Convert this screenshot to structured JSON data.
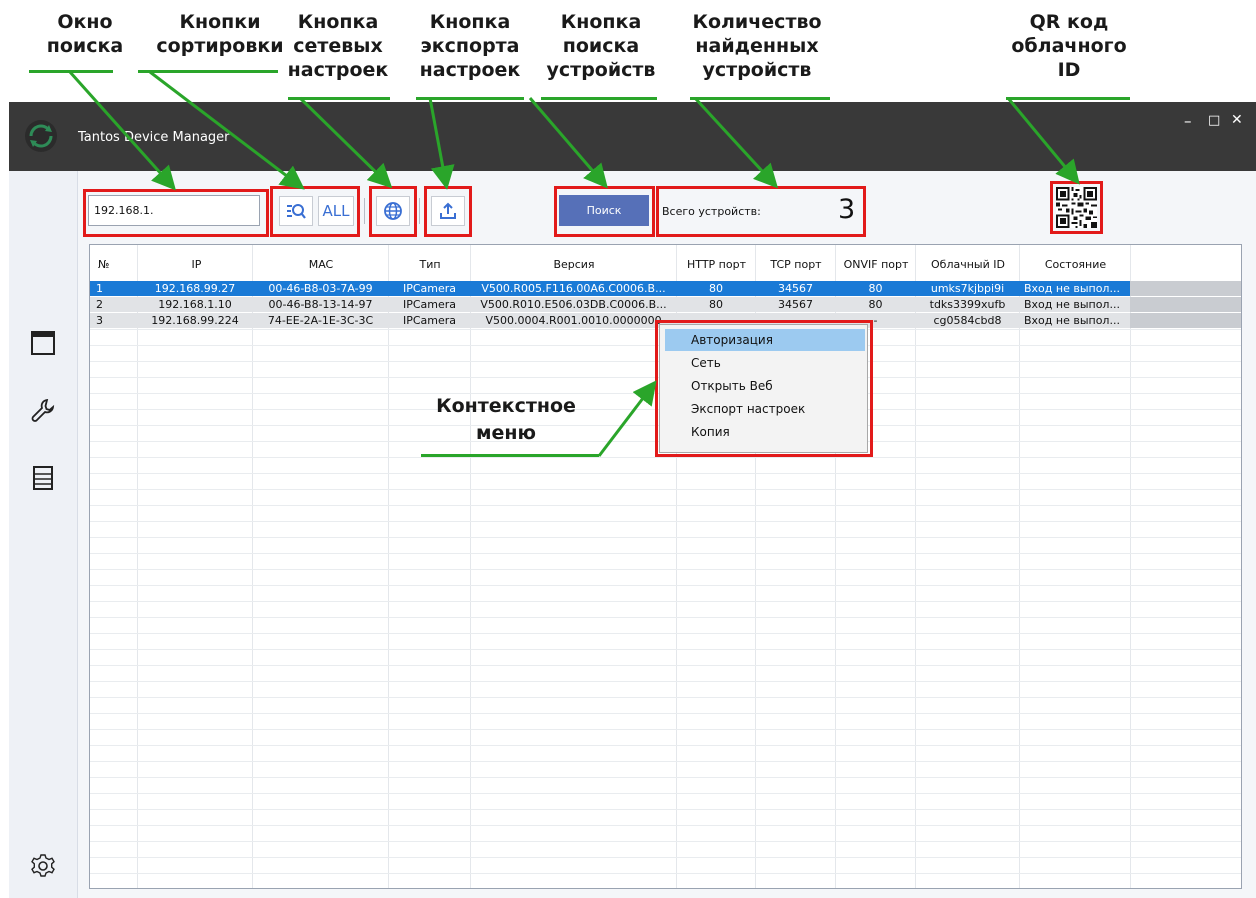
{
  "annotations": {
    "search_window": [
      "Окно",
      "поиска"
    ],
    "sort_buttons": [
      "Кнопки",
      "сортировки"
    ],
    "network_button": [
      "Кнопка",
      "сетевых",
      "настроек"
    ],
    "export_button": [
      "Кнопка",
      "экспорта",
      "настроек"
    ],
    "search_button": [
      "Кнопка",
      "поиска",
      "устройств"
    ],
    "device_count": [
      "Количество",
      "найденных",
      "устройств"
    ],
    "qr_code": [
      "QR код",
      "облачного",
      "ID"
    ],
    "context_menu": [
      "Контекстное",
      "меню"
    ]
  },
  "window": {
    "title": "Tantos Device Manager",
    "minimize": "–",
    "maximize": "□",
    "close": "✕"
  },
  "toolbar": {
    "search_value": "192.168.1.",
    "all_label": "ALL",
    "search_button": "Поиск",
    "count_label": "Всего устройств:",
    "count_value": "3"
  },
  "table": {
    "headers": [
      "№",
      "IP",
      "MAC",
      "Тип",
      "Версия",
      "HTTP порт",
      "TCP порт",
      "ONVIF порт",
      "Облачный ID",
      "Состояние"
    ],
    "rows": [
      [
        "1",
        "192.168.99.27",
        "00-46-B8-03-7A-99",
        "IPCamera",
        "V500.R005.F116.00A6.C0006.B...",
        "80",
        "34567",
        "80",
        "umks7kjbpi9i",
        "Вход не выпол..."
      ],
      [
        "2",
        "192.168.1.10",
        "00-46-B8-13-14-97",
        "IPCamera",
        "V500.R010.E506.03DB.C0006.B...",
        "80",
        "34567",
        "80",
        "tdks3399xufb",
        "Вход не выпол..."
      ],
      [
        "3",
        "192.168.99.224",
        "74-EE-2A-1E-3C-3C",
        "IPCamera",
        "V500.0004.R001.0010.0000000",
        "",
        "",
        "-",
        "cg0584cbd8",
        "Вход не выпол..."
      ]
    ]
  },
  "context_menu": {
    "items": [
      "Авторизация",
      "Сеть",
      "Открыть Веб",
      "Экспорт настроек",
      "Копия"
    ]
  },
  "colors": {
    "titlebar": "#393939",
    "selection": "#1a7ad6",
    "row_gray": "#c9ccd1",
    "highlight": "#e21a1a",
    "arrow": "#2aa52a",
    "search_button": "#5670b8"
  }
}
